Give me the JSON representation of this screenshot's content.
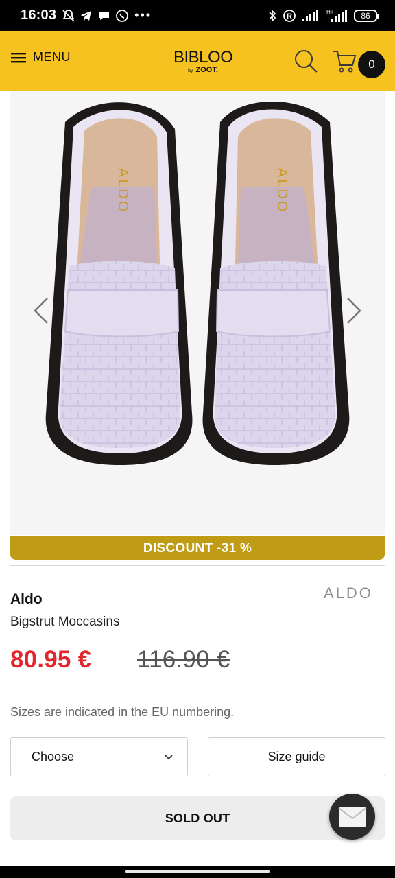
{
  "status_bar": {
    "time": "16:03",
    "battery": "86",
    "icons": [
      "mute-bell-icon",
      "telegram-icon",
      "message-icon",
      "viber-icon",
      "more-dots-icon",
      "bluetooth-icon",
      "registered-icon",
      "signal-icon",
      "signal-hplus-icon",
      "battery-icon"
    ]
  },
  "header": {
    "menu_label": "MENU",
    "logo_main": "BIBLOO",
    "logo_by": "by",
    "logo_sub": "ZOOT.",
    "cart_count": "0",
    "accent_color": "#f6c21f"
  },
  "gallery": {
    "image": "lilac croc-embossed loafers, top view",
    "insole_text": "ALDO"
  },
  "product": {
    "discount_label": "DISCOUNT -31 %",
    "brand": "Aldo",
    "brand_logo_text": "ALDO",
    "name": "Bigstrut Moccasins",
    "price": "80.95 €",
    "old_price": "116.90 €",
    "size_note": "Sizes are indicated in the EU numbering.",
    "size_select_value": "Choose",
    "size_guide_label": "Size guide",
    "sold_out_label": "SOLD OUT",
    "price_color": "#e0282e",
    "discount_color": "#c09c16"
  }
}
